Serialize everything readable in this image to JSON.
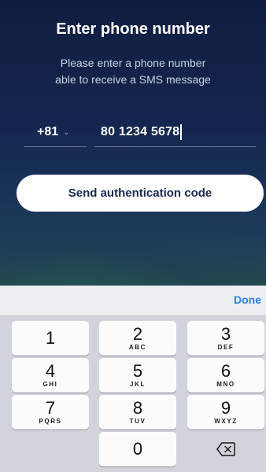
{
  "header": {
    "title": "Enter phone number",
    "subtitle_line1": "Please enter a phone number",
    "subtitle_line2": "able to receive a SMS message"
  },
  "phone": {
    "country_code": "+81",
    "number": "80 1234 5678"
  },
  "send_button": "Send authentication code",
  "keyboard": {
    "done_label": "Done",
    "keys": [
      {
        "digit": "1",
        "letters": ""
      },
      {
        "digit": "2",
        "letters": "ABC"
      },
      {
        "digit": "3",
        "letters": "DEF"
      },
      {
        "digit": "4",
        "letters": "GHI"
      },
      {
        "digit": "5",
        "letters": "JKL"
      },
      {
        "digit": "6",
        "letters": "MNO"
      },
      {
        "digit": "7",
        "letters": "PQRS"
      },
      {
        "digit": "8",
        "letters": "TUV"
      },
      {
        "digit": "9",
        "letters": "WXYZ"
      },
      {
        "digit": "0",
        "letters": ""
      }
    ],
    "delete_icon": "backspace-icon"
  },
  "colors": {
    "accent": "#2f7cf6",
    "background_top": "#101d3f",
    "button_text": "#1b2a52"
  }
}
